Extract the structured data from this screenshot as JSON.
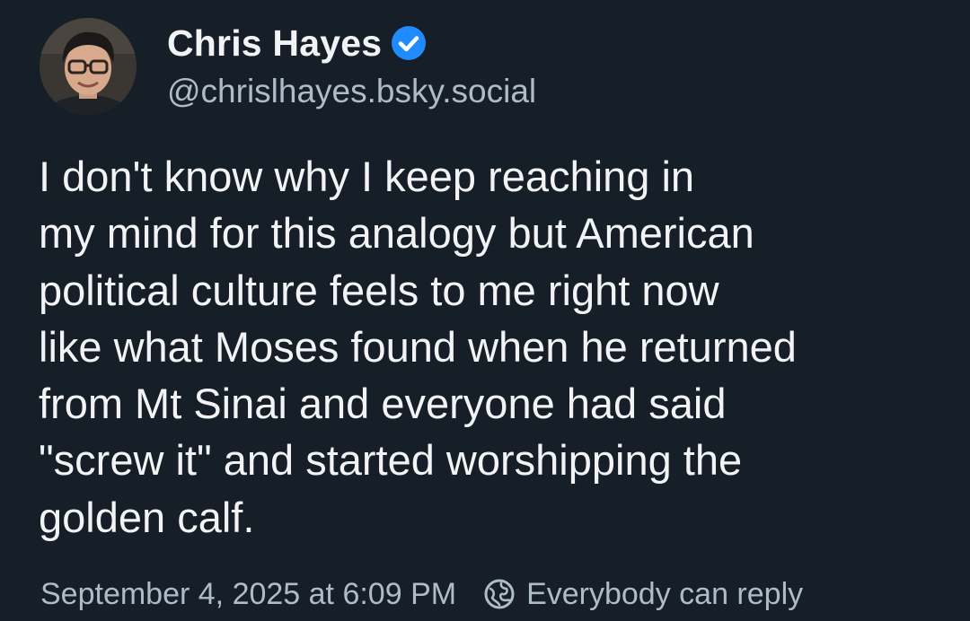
{
  "post": {
    "author": {
      "display_name": "Chris Hayes",
      "handle": "@chrislhayes.bsky.social",
      "verified": true,
      "verified_icon": "verified-check-icon",
      "verified_color": "#208bfe"
    },
    "text": "I don't know why I keep reaching in\nmy mind for this analogy but American\npolitical culture feels to me right now\nlike what Moses found when he returned\nfrom Mt Sinai and everyone had said\n\"screw it\" and started worshipping the\ngolden calf.",
    "timestamp": "September 4, 2025 at 6:09 PM",
    "reply_setting": {
      "icon": "globe-icon",
      "label": "Everybody can reply"
    }
  },
  "colors": {
    "background": "#161e27",
    "primary_text": "#f1f3f5",
    "secondary_text": "#aebbc9",
    "accent": "#208bfe"
  }
}
